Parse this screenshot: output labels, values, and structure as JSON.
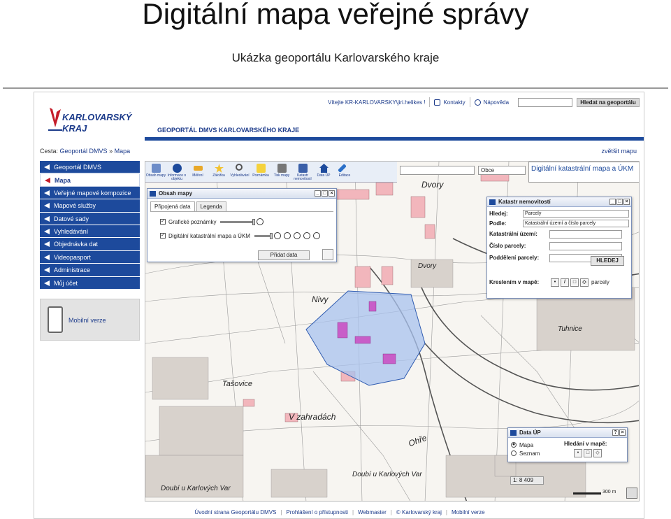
{
  "slide": {
    "title": "Digitální mapa veřejné správy",
    "subtitle": "Ukázka geoportálu Karlovarského kraje"
  },
  "header": {
    "logo_line1": "KARLOVARSKÝ",
    "logo_line2": "KRAJ",
    "portal_title": "GEOPORTÁL DMVS KARLOVARSKÉHO KRAJE",
    "welcome": "Vítejte KR-KARLOVARSKY\\jiri.helikes !",
    "contacts": "Kontakty",
    "help": "Nápověda",
    "search_button": "Hledat na geoportálu",
    "search_placeholder": ""
  },
  "breadcrumb": {
    "label": "Cesta:",
    "part1": "Geoportál DMVS",
    "sep": "»",
    "part2": "Mapa"
  },
  "enlarge_map": "zvětšit mapu",
  "sidebar": {
    "items": [
      {
        "label": "Geoportál DMVS"
      },
      {
        "label": "Mapa"
      },
      {
        "label": "Veřejné mapové kompozice"
      },
      {
        "label": "Mapové služby"
      },
      {
        "label": "Datové sady"
      },
      {
        "label": "Vyhledávání"
      },
      {
        "label": "Objednávka dat"
      },
      {
        "label": "Videopasport"
      },
      {
        "label": "Administrace"
      },
      {
        "label": "Můj účet"
      }
    ],
    "active_index": 1,
    "mobile_label": "Mobilní verze"
  },
  "toolbar": {
    "tools": [
      {
        "label": "Obsah mapy",
        "icon": "layers-icon"
      },
      {
        "label": "Informace o objektu",
        "icon": "info-icon"
      },
      {
        "label": "Měření",
        "icon": "ruler-icon"
      },
      {
        "label": "Záložka",
        "icon": "star-icon"
      },
      {
        "label": "Vyhledávání",
        "icon": "magnifier-icon"
      },
      {
        "label": "Poznámka",
        "icon": "note-icon"
      },
      {
        "label": "Tisk mapy",
        "icon": "printer-icon"
      },
      {
        "label": "Katastr nemovitostí",
        "icon": "cadastre-icon"
      },
      {
        "label": "Data ÚP",
        "icon": "house-icon"
      },
      {
        "label": "Editace",
        "icon": "pencil-icon"
      }
    ],
    "obec_select": "Obce",
    "layer_select": "Digitální katastrální mapa a ÚKM"
  },
  "map_labels": {
    "dvory_top": "Dvory",
    "dvory": "Dvory",
    "nivy": "Nivy",
    "tasovice": "Tašovice",
    "v_zahradach": "V zahradách",
    "ohre": "Ohře",
    "tuhnice": "Tuhnice",
    "doubi1": "Doubí u Karlových Var",
    "doubi2": "Doubí u Karlových Var"
  },
  "obsah_mapy": {
    "title": "Obsah mapy",
    "tab1": "Připojená data",
    "tab2": "Legenda",
    "layer1": "Grafické poznámky",
    "layer2": "Digitální katastrální mapa a ÚKM",
    "add_button": "Přidat data"
  },
  "katastr": {
    "title": "Katastr nemovitostí",
    "hledej_label": "Hledej:",
    "hledej_value": "Parcely",
    "podle_label": "Podle:",
    "podle_value": "Katastrální území a číslo parcely",
    "field1": "Katastrální území:",
    "field2": "Číslo parcely:",
    "field3": "Poddělení parcely:",
    "search_button": "HLEDEJ",
    "draw_label": "Kreslením v mapě:",
    "draw_suffix": "parcely"
  },
  "data_up": {
    "title": "Data ÚP",
    "radio1": "Mapa",
    "radio2": "Seznam",
    "search_label": "Hledání v mapě:"
  },
  "map_status": {
    "scale": "1: 8 409",
    "scale_bar": "300 m"
  },
  "footer": {
    "links": [
      "Úvodní strana Geoportálu DMVS",
      "Prohlášení o přístupnosti",
      "Webmaster",
      "© Karlovarský kraj",
      "Mobilní verze"
    ]
  },
  "colors": {
    "brand_blue": "#1d4a9c",
    "brand_red": "#c41d2a"
  }
}
